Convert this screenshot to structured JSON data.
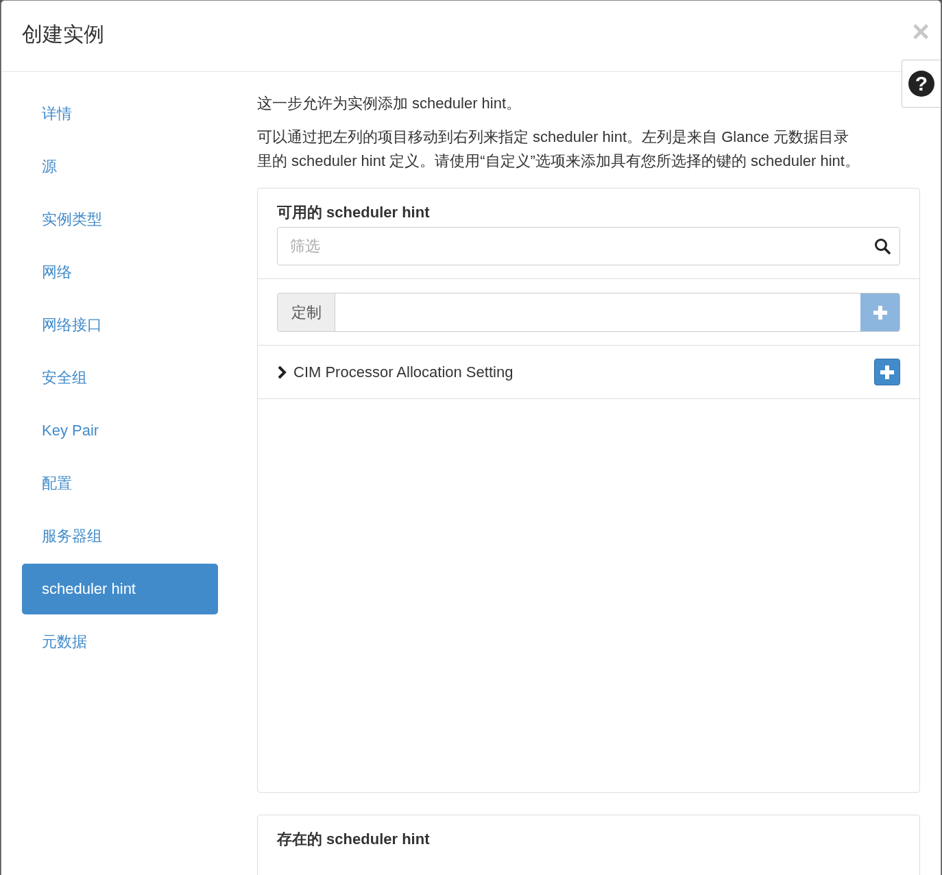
{
  "window": {
    "title": "创建实例",
    "close": "×",
    "help": "?"
  },
  "sidebar": {
    "items": [
      {
        "label": "详情",
        "selected": false
      },
      {
        "label": "源",
        "selected": false
      },
      {
        "label": "实例类型",
        "selected": false
      },
      {
        "label": "网络",
        "selected": false
      },
      {
        "label": "网络接口",
        "selected": false
      },
      {
        "label": "安全组",
        "selected": false
      },
      {
        "label": "Key Pair",
        "selected": false
      },
      {
        "label": "配置",
        "selected": false
      },
      {
        "label": "服务器组",
        "selected": false
      },
      {
        "label": "scheduler hint",
        "selected": true
      },
      {
        "label": "元数据",
        "selected": false
      }
    ]
  },
  "intro": [
    "这一步允许为实例添加 scheduler hint。",
    "可以通过把左列的项目移动到右列来指定 scheduler hint。左列是来自 Glance 元数据目录里的 scheduler hint 定义。请使用“自定义”选项来添加具有您所选择的键的 scheduler hint。"
  ],
  "available": {
    "title": "可用的 scheduler hint",
    "search": {
      "placeholder": "筛选"
    },
    "custom": {
      "label": "定制",
      "add_disabled": true
    },
    "items": [
      {
        "label": "CIM Processor Allocation Setting",
        "expanded": false
      }
    ]
  },
  "existing": {
    "title": "存在的 scheduler hint"
  }
}
